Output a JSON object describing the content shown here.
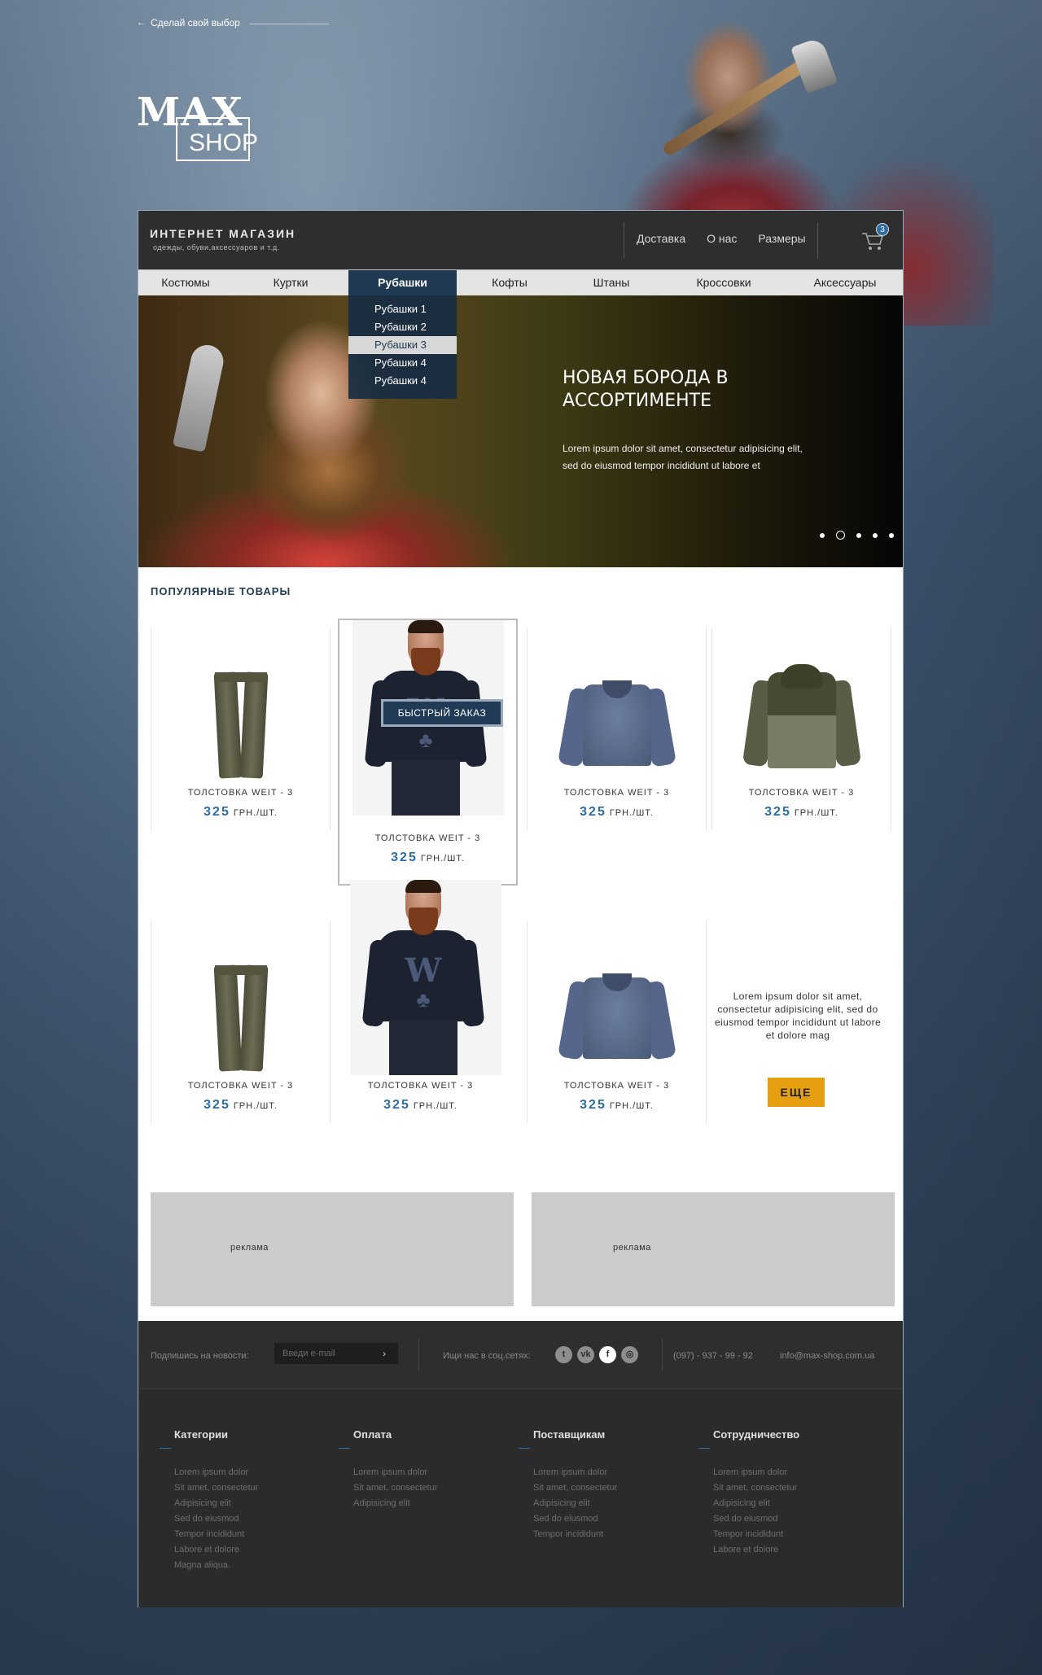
{
  "top": {
    "back_link": "Сделай свой выбор",
    "logo_max": "MAX",
    "logo_shop": "SHOP"
  },
  "header": {
    "title": "ИНТЕРНЕТ МАГАЗИН",
    "subtitle": "одежды, обуви,аксессуаров и т.д.",
    "nav": [
      "Доставка",
      "О нас",
      "Размеры"
    ],
    "cart_count": "3"
  },
  "categories": [
    "Костюмы",
    "Куртки",
    "Рубашки",
    "Кофты",
    "Штаны",
    "Кроссовки",
    "Аксессуары"
  ],
  "dropdown": [
    "Рубашки 1",
    "Рубашки 2",
    "Рубашки 3",
    "Рубашки 4",
    "Рубашки 4"
  ],
  "hero": {
    "title": "НОВАЯ БОРОДА В АССОРТИМЕНТЕ",
    "text": "Lorem ipsum dolor sit amet, consectetur adipisicing elit, sed do eiusmod tempor incididunt ut labore et",
    "slides": 5,
    "active_slide": 2
  },
  "popular_title": "ПОПУЛЯРНЫЕ ТОВАРЫ",
  "products": [
    {
      "name": "ТОЛСТОВКА WEIT - 3",
      "price": "325",
      "unit": "ГРН./ШТ.",
      "image": "pants"
    },
    {
      "name": "ТОЛСТОВКА WEIT - 3",
      "price": "325",
      "unit": "ГРН./ШТ.",
      "image": "model-sweatshirt"
    },
    {
      "name": "ТОЛСТОВКА WEIT - 3",
      "price": "325",
      "unit": "ГРН./ШТ.",
      "image": "knit-sweater"
    },
    {
      "name": "ТОЛСТОВКА WEIT - 3",
      "price": "325",
      "unit": "ГРН./ШТ.",
      "image": "jacket"
    },
    {
      "name": "ТОЛСТОВКА WEIT - 3",
      "price": "325",
      "unit": "ГРН./ШТ.",
      "image": "pants"
    },
    {
      "name": "ТОЛСТОВКА WEIT - 3",
      "price": "325",
      "unit": "ГРН./ШТ.",
      "image": "model-sweatshirt"
    },
    {
      "name": "ТОЛСТОВКА WEIT - 3",
      "price": "325",
      "unit": "ГРН./ШТ.",
      "image": "knit-sweater"
    }
  ],
  "quick_order": "БЫСТРЫЙ ЗАКАЗ",
  "promo": {
    "text": "Lorem ipsum dolor sit amet, consectetur adipisicing elit, sed do eiusmod tempor incididunt ut labore et dolore mag",
    "button": "ЕЩЕ"
  },
  "ads": [
    "реклама",
    "реклама"
  ],
  "subscribe": {
    "label": "Подпишись на новости:",
    "placeholder": "Введи e-mail",
    "social_label": "Ищи нас в соц.сетях:",
    "social": [
      "twitter-icon",
      "vk-icon",
      "facebook-icon",
      "instagram-icon"
    ],
    "phone": "(097) - 937 -  99 -  92",
    "email": "info@max-shop.com.ua"
  },
  "footer": [
    {
      "title": "Категории",
      "items": [
        "Lorem ipsum dolor",
        "Sit amet, consectetur",
        "Adipisicing elit",
        "Sed do eiusmod",
        "Tempor incididunt",
        "Labore et dolore",
        "Magna aliqua."
      ]
    },
    {
      "title": "Оплата",
      "items": [
        "Lorem ipsum dolor",
        "Sit amet, consectetur",
        "Adipisicing elit"
      ]
    },
    {
      "title": "Поставщикам",
      "items": [
        "Lorem ipsum dolor",
        "Sit amet, consectetur",
        "Adipisicing elit",
        "Sed do eiusmod",
        "Tempor incididunt"
      ]
    },
    {
      "title": "Сотрудничество",
      "items": [
        "Lorem ipsum dolor",
        "Sit amet, consectetur",
        "Adipisicing elit",
        "Sed do eiusmod",
        "Tempor incididunt",
        "Labore et dolore"
      ]
    }
  ]
}
